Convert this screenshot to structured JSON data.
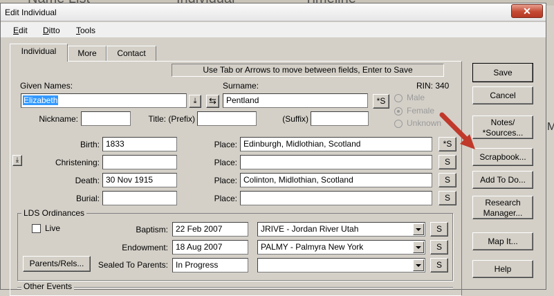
{
  "background": {
    "tabs": [
      "Name List",
      "Individual",
      "Timeline"
    ]
  },
  "window": {
    "title": "Edit Individual",
    "close_icon": "close-icon"
  },
  "menu": [
    {
      "label": "Edit",
      "key": "E"
    },
    {
      "label": "Ditto",
      "key": "D"
    },
    {
      "label": "Tools",
      "key": "T"
    }
  ],
  "tabs": {
    "individual": "Individual",
    "more": "More",
    "contact": "Contact"
  },
  "hint": "Use Tab or Arrows to move between fields, Enter to Save",
  "names": {
    "given_label": "Given Names:",
    "given_value": "Elizabeth",
    "surname_label": "Surname:",
    "surname_value": "Pentland",
    "rin": "RIN: 340",
    "s_button": "*S",
    "nickname_label": "Nickname:",
    "title_label": "Title: (Prefix)",
    "suffix_label": "(Suffix)"
  },
  "sex": {
    "male": "Male",
    "female": "Female",
    "unknown": "Unknown",
    "selected": "Female"
  },
  "events": [
    {
      "label": "Birth:",
      "date": "1833",
      "place": "Edinburgh, Midlothian, Scotland",
      "s": "*S"
    },
    {
      "label": "Christening:",
      "date": "",
      "place": "",
      "s": "S"
    },
    {
      "label": "Death:",
      "date": "30 Nov 1915",
      "place": "Colinton, Midlothian, Scotland",
      "s": "S"
    },
    {
      "label": "Burial:",
      "date": "",
      "place": "",
      "s": "S"
    }
  ],
  "place_label": "Place:",
  "lds": {
    "title": "LDS Ordinances",
    "live_label": "Live",
    "parents_button": "Parents/Rels...",
    "rows": [
      {
        "label": "Baptism:",
        "date": "22 Feb 2007",
        "temple": "JRIVE - Jordan River Utah",
        "s": "S"
      },
      {
        "label": "Endowment:",
        "date": "18 Aug 2007",
        "temple": "PALMY - Palmyra New York",
        "s": "S"
      },
      {
        "label": "Sealed To Parents:",
        "date": "In Progress",
        "temple": "",
        "s": "S"
      }
    ]
  },
  "other_events": "Other Events",
  "side_buttons": {
    "save": "Save",
    "cancel": "Cancel",
    "notes_1": "Notes/",
    "notes_2": "*Sources...",
    "scrapbook": "Scrapbook...",
    "add_todo": "Add To Do...",
    "research_1": "Research",
    "research_2": "Manager...",
    "map": "Map It...",
    "help": "Help"
  },
  "colors": {
    "selection": "#3399ff",
    "annotation_arrow": "#c0392b",
    "close_button": "#c44a33"
  }
}
